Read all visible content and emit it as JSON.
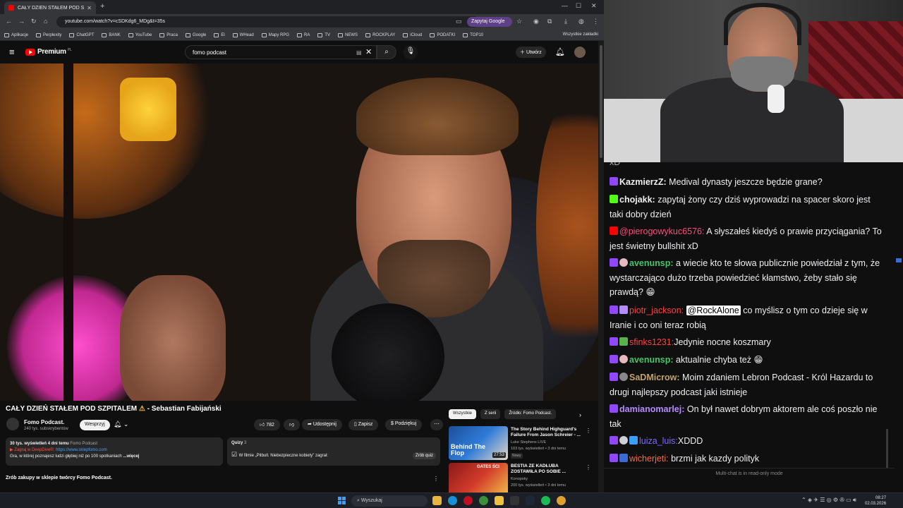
{
  "browser": {
    "tab_title": "CAŁY DZIEŃ STAŁEM POD SZPI",
    "url": "youtube.com/watch?v=cSDKdg6_MDg&t=35s",
    "ask_google": "Zapytaj Google",
    "bookmarks": [
      "Aplikacje",
      "Perplexity",
      "ChatGPT",
      "BANK",
      "YouTube",
      "Praca",
      "Google",
      "El",
      "WHead",
      "Mapy RPG",
      "RA",
      "TV",
      "NEWS",
      "ROCKPLAY",
      "iCloud",
      "PODATKI",
      "TOP10"
    ],
    "all_bookmarks": "Wszystkie zakładki"
  },
  "youtube": {
    "logo": "Premium",
    "logo_country": "PL",
    "search_value": "fomo podcast",
    "create_label": "Utwórz",
    "video_title_main": "CAŁY DZIEŃ STAŁEM POD SZPITALEM",
    "video_title_rest": "- Sebastian Fabijański",
    "channel_name": "Fomo Podcast.",
    "channel_subs": "240 tys. subskrybentów",
    "support_label": "Wesprzyj",
    "likes": "782",
    "share_label": "Udostępnij",
    "save_label": "Zapisz",
    "thanks_label": "Podziękuj",
    "desc_stats": "30 tys. wyświetleń  4 dni temu",
    "desc_channel": "Fomo Podcast",
    "desc_line2_prefix": "Zagraj w DeepDive®:",
    "desc_link": "https://www.sklepfomo.com",
    "desc_line3": "Gra, w której poznajesz ludzi głębiej niż po 100 spotkaniach",
    "desc_more": "...więcej",
    "quiz_title": "Quizy",
    "quiz_count": "3",
    "quiz_question": "W filmie „Pitbull. Niebezpieczne kobiety” zagrał:",
    "quiz_button": "Zrób quiz",
    "shop_title": "Zrób zakupy w sklepie twórcy Fomo Podcast.",
    "chips": [
      "Wszystkie",
      "Z serii",
      "Źródło: Fomo Podcast."
    ],
    "recommendations": [
      {
        "title": "The Story Behind Highguard's Failure From Jason Schreier - ...",
        "channel": "Luke Stephens LIVE",
        "meta": "103 tys. wyświetleń • 3 dni temu",
        "badge": "Nowy",
        "duration": "27:53",
        "thumb_text": "Behind The Flop"
      },
      {
        "title": "BESTIA ZE KADŁUBA ZOSTAWIŁA PO SOBIE ...",
        "channel": "Konopsky",
        "meta": "200 tys. wyświetleń • 3 dni temu",
        "badge": "",
        "duration": "",
        "thumb_text": "GATES ŚCI"
      }
    ]
  },
  "chat": {
    "messages": [
      {
        "user": "KazmierzZ:",
        "color": "#ffffff",
        "text": "Medival dynasty jeszcze będzie grane?"
      },
      {
        "user": "chojakk:",
        "color": "#ffffff",
        "text": "zapytaj żony czy dziś wyprowadzi na spacer skoro jest taki dobry dzień"
      },
      {
        "user": "@pierogowykuc6576:",
        "color": "#ff4c7a",
        "text": "A słyszałeś kiedyś o prawie przyciągania? To jest świetny bullshit xD"
      },
      {
        "user": "avenunsp:",
        "color": "#46c46a",
        "text": "a wiecie kto te słowa publicznie powiedział z tym, że wystarczająco dużo trzeba powiedzieć kłamstwo, żeby stało się prawdą?"
      },
      {
        "user": "piotr_jackson:",
        "color": "#ff4040",
        "mention": "@RockAlone",
        "text": "co myślisz o tym co dzieje się w Iranie i co oni teraz robią"
      },
      {
        "user": "sfinks1231:",
        "color": "#ff4040",
        "text": "Jedynie nocne koszmary"
      },
      {
        "user": "avenunsp:",
        "color": "#46c46a",
        "text": "aktualnie chyba też"
      },
      {
        "user": "SaDMicrow:",
        "color": "#c6a16a",
        "text": "Moim zdaniem Lebron Podcast - Król Hazardu to drugi najlepszy podcast jaki istnieje"
      },
      {
        "user": "damianomarlej:",
        "color": "#b58cff",
        "text": "On był nawet dobrym aktorem ale coś poszło nie tak"
      },
      {
        "user": "luiza_luis:",
        "color": "#7b6cff",
        "text": "XDDD"
      },
      {
        "user": "wicherjeti:",
        "color": "#ff6a3d",
        "text": "brzmi jak kazdy polityk"
      }
    ],
    "read_only": "Multi-chat is in read-only mode"
  },
  "taskbar": {
    "search": "Wyszukaj",
    "time": "08:27",
    "date": "02.03.2026"
  }
}
